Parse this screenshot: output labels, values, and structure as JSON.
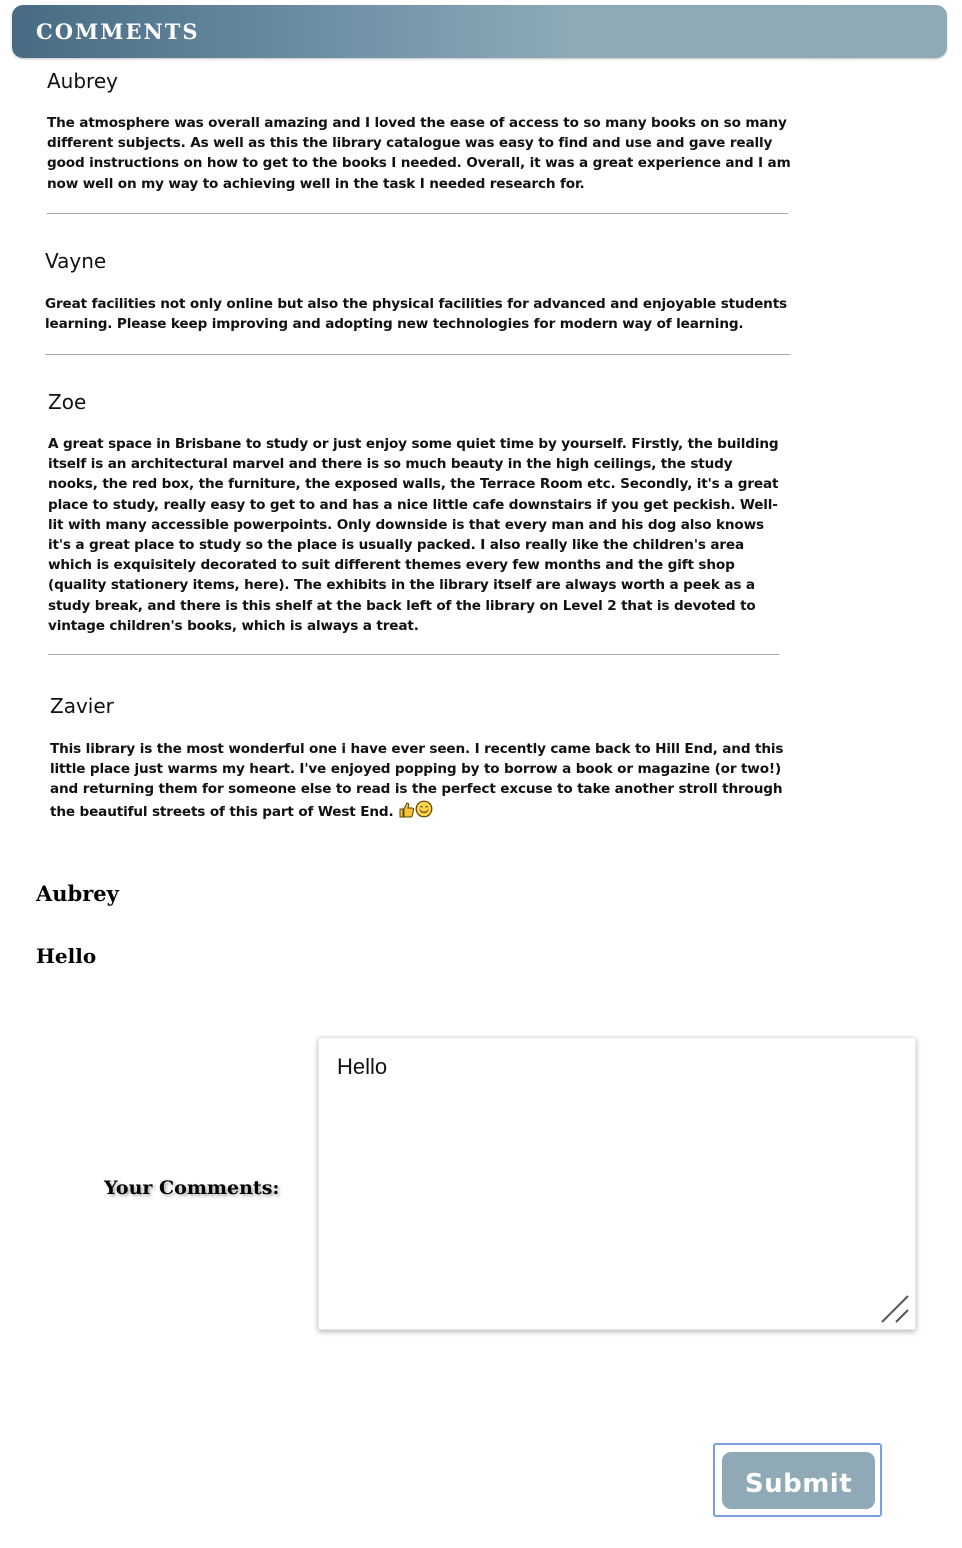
{
  "header": {
    "title": "COMMENTS"
  },
  "comments": [
    {
      "name": "Aubrey",
      "text": "The atmosphere was overall amazing and I loved the ease of access to so many books on so many different subjects. As well as this the library catalogue was easy to find and use and gave really good instructions on how to get to the books I needed. Overall, it was a great experience and I am now well on my way to achieving well in the task I needed research for."
    },
    {
      "name": "Vayne",
      "text": "Great facilities not only online but also the physical facilities for advanced and enjoyable students learning. Please keep improving and adopting new technologies for modern way of learning."
    },
    {
      "name": "Zoe",
      "text": "A great space in Brisbane to study or just enjoy some quiet time by yourself. Firstly, the building itself is an architectural marvel and there is so much beauty in the high ceilings, the study nooks, the red box, the furniture, the exposed walls, the Terrace Room etc. Secondly, it's a great place to study, really easy to get to and has a nice little cafe downstairs if you get peckish. Well-lit with many accessible powerpoints. Only downside is that every man and his dog also knows it's a great place to study so the place is usually packed. I also really like the children's area which is exquisitely decorated to suit different themes every few months and the gift shop (quality stationery items, here). The exhibits in the library itself are always worth a peek as a study break, and there is this shelf at the back left of the library on Level 2 that is devoted to vintage children's books, which is always a treat."
    },
    {
      "name": "Zavier",
      "text": "This library is the most wonderful one i have ever seen. I recently came back to Hill End, and this little place just warms my heart. I've enjoyed popping by to borrow a book or magazine (or two!) and returning them for someone else to read is the perfect excuse to take another stroll through the beautiful streets of this part of West End."
    }
  ],
  "posted": {
    "name": "Aubrey",
    "text": "Hello"
  },
  "form": {
    "label": "Your Comments:",
    "textarea_value": "Hello",
    "submit_label": "Submit"
  },
  "icons": {
    "emoji_1": "thumbs-up-icon",
    "emoji_2": "smiling-face-icon",
    "resize": "resize-grip-icon"
  },
  "colors": {
    "header_gradient_start": "#476b84",
    "header_gradient_end": "#90a9b6",
    "submit_bg": "#90a9b6",
    "focus_ring": "#7a9fe8"
  }
}
